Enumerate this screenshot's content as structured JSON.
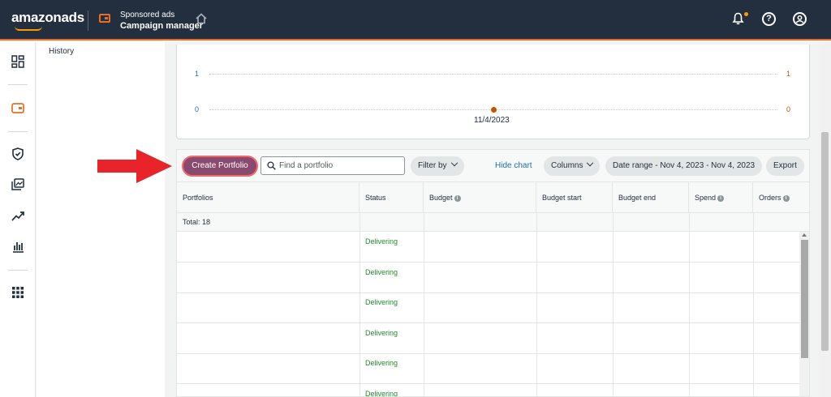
{
  "header": {
    "logo": "amazonads",
    "app_subtitle": "Sponsored ads",
    "app_title": "Campaign manager",
    "icons": [
      "home-icon",
      "bell-icon",
      "help-icon",
      "account-icon"
    ],
    "help_glyph": "?"
  },
  "side_panel": {
    "history_label": "History"
  },
  "chart": {
    "left_ticks": [
      "1",
      "0"
    ],
    "right_ticks": [
      "1",
      "0"
    ],
    "x_tick": "11/4/2023",
    "colors": {
      "left_axis": "#1f6fb2",
      "right_axis": "#c45500"
    }
  },
  "chart_data": {
    "type": "line",
    "x": [
      "11/4/2023"
    ],
    "series": [
      {
        "axis": "left",
        "values": [
          0
        ]
      },
      {
        "axis": "right",
        "values": [
          0
        ]
      }
    ],
    "ylim_left": [
      0,
      1
    ],
    "ylim_right": [
      0,
      1
    ],
    "grid": true
  },
  "toolbar": {
    "create_label": "Create Portfolio",
    "search_placeholder": "Find a portfolio",
    "filter_label": "Filter by",
    "hide_chart_label": "Hide chart",
    "columns_label": "Columns",
    "date_range_label": "Date range - Nov 4, 2023 - Nov 4, 2023",
    "export_label": "Export"
  },
  "table": {
    "columns": [
      "Portfolios",
      "Status",
      "Budget",
      "Budget start",
      "Budget end",
      "Spend",
      "Orders"
    ],
    "total_label": "Total: 18",
    "rows": [
      {
        "status": "Delivering"
      },
      {
        "status": "Delivering"
      },
      {
        "status": "Delivering"
      },
      {
        "status": "Delivering"
      },
      {
        "status": "Delivering"
      },
      {
        "status": "Delivering"
      }
    ]
  },
  "colors": {
    "topbar": "#232f3e",
    "accent": "#e76f24",
    "create_button": "#8a4a6e",
    "status_green": "#1e8c2c",
    "annotation_arrow": "#e8232a"
  }
}
